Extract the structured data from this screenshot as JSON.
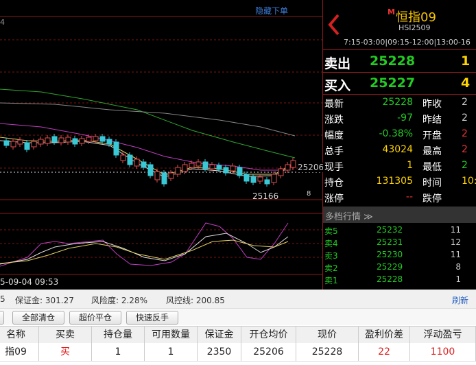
{
  "chart": {
    "hide_order_label": "隐藏下单",
    "corner_digit": "4",
    "price_label_right": "25206",
    "low_label": "25166",
    "edge_digit": "8",
    "date_label": "5-09-04 09:53"
  },
  "quote": {
    "m_badge": "M",
    "name": "恒指09",
    "code": "HSI2509",
    "session": "7:15-03:00|09:15-12:00|13:00-16",
    "sell": {
      "label": "卖出",
      "price": "25228",
      "volume": "1"
    },
    "buy": {
      "label": "买入",
      "price": "25227",
      "volume": "4"
    },
    "rows": [
      {
        "l": "最新",
        "v": "25228",
        "c": "#22cc22",
        "l2": "昨收",
        "v2": "2",
        "c2": "#ccc"
      },
      {
        "l": "涨跌",
        "v": "-97",
        "c": "#22cc22",
        "l2": "昨结",
        "v2": "2",
        "c2": "#ccc"
      },
      {
        "l": "幅度",
        "v": "-0.38%",
        "c": "#22cc22",
        "l2": "开盘",
        "v2": "2",
        "c2": "#e33"
      },
      {
        "l": "总手",
        "v": "43024",
        "c": "#ffd400",
        "l2": "最高",
        "v2": "2",
        "c2": "#e33"
      },
      {
        "l": "现手",
        "v": "1",
        "c": "#ffd400",
        "l2": "最低",
        "v2": "2",
        "c2": "#22cc22"
      },
      {
        "l": "持仓",
        "v": "131305",
        "c": "#ffd400",
        "l2": "时间",
        "v2": "10:",
        "c2": "#ffd400"
      },
      {
        "l": "涨停",
        "v": "--",
        "c": "#e33",
        "l2": "跌停",
        "v2": "",
        "c2": "#ccc"
      }
    ],
    "depth_title": "多档行情 ≫",
    "depth": [
      {
        "l": "卖5",
        "p": "25232",
        "v": "11"
      },
      {
        "l": "卖4",
        "p": "25231",
        "v": "12"
      },
      {
        "l": "卖3",
        "p": "25230",
        "v": "11"
      },
      {
        "l": "卖2",
        "p": "25229",
        "v": "8"
      },
      {
        "l": "卖1",
        "p": "25228",
        "v": "1"
      }
    ]
  },
  "account": {
    "left_digit": "5",
    "margin": "保证金: 301.27",
    "risk": "风险度: 2.28%",
    "risk_line": "风控线: 200.85",
    "refresh": "刷新"
  },
  "buttons": {
    "clear_all": "全部清仓",
    "super_close": "超价平仓",
    "fast_reverse": "快速反手"
  },
  "table": {
    "headers": [
      "名称",
      "买卖",
      "持仓量",
      "可用数量",
      "保证金",
      "开仓均价",
      "现价",
      "盈利价差",
      "浮动盈亏"
    ],
    "row": [
      "指09",
      "买",
      "1",
      "1",
      "2350",
      "25206",
      "25228",
      "22",
      "1100"
    ]
  }
}
